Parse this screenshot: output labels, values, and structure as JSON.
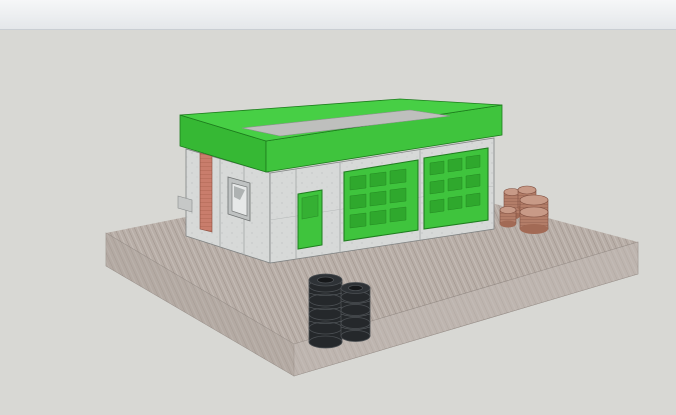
{
  "viewer": {
    "toolbar_label": "",
    "scene": "garage-3d-model"
  },
  "scene": {
    "roof_color": "#3dc43a",
    "door_color": "#3fc43d",
    "wall_color": "#d7d9d8",
    "pavement_color": "#b8aea7",
    "background_color": "#d8d8d4",
    "tire_color": "#25282b",
    "barrel_color": "#b37d68"
  }
}
